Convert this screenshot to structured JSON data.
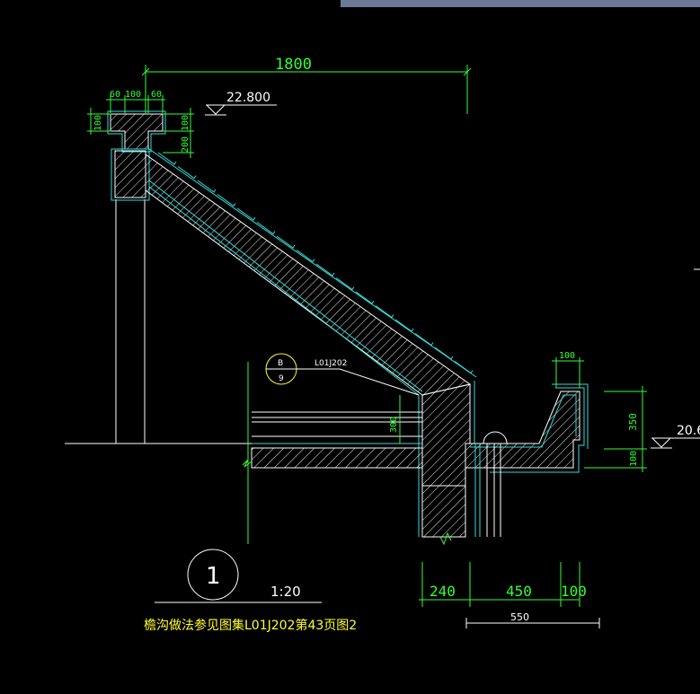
{
  "dimensions": {
    "top_span": "1800",
    "parapet_w1": "60",
    "parapet_w2": "100",
    "parapet_w3": "60",
    "parapet_h1": "100",
    "parapet_h2": "100",
    "parapet_h3": "200",
    "gutter_top": "100",
    "gutter_depth": "350",
    "gutter_bottom": "100",
    "slab_thick": "300",
    "bottom_a": "240",
    "bottom_b": "450",
    "bottom_c": "100",
    "bottom_total": "550"
  },
  "elevations": {
    "top": "22.800",
    "right": "20.6"
  },
  "reference": {
    "top": "B",
    "bottom": "9",
    "atlas": "L01J202"
  },
  "detail": {
    "number": "1",
    "scale": "1:20",
    "note": "檐沟做法参见图集L01J202第43页图2"
  },
  "colors": {
    "background": "#000000",
    "concrete_outline": "#ffffff",
    "finish_lines": "#33dddd",
    "dimension": "#33ff33",
    "note": "#ffff33"
  }
}
